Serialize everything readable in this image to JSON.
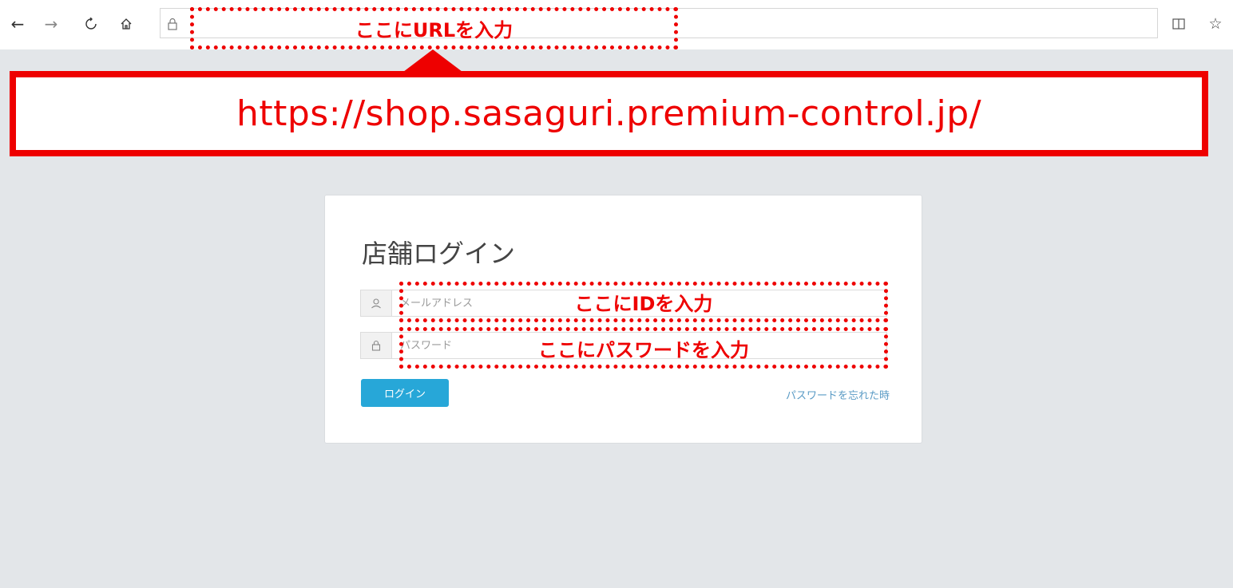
{
  "browser": {
    "back_icon": "arrow-left-icon",
    "forward_icon": "arrow-right-icon",
    "refresh_icon": "refresh-icon",
    "home_icon": "home-icon",
    "lock_icon": "lock-icon",
    "url_value": "",
    "reading_icon": "book-icon",
    "favorite_icon": "star-icon"
  },
  "annotations": {
    "url_hint": "ここにURLを入力",
    "url_banner": "https://shop.sasaguri.premium-control.jp/",
    "id_hint": "ここにIDを入力",
    "password_hint": "ここにパスワードを入力",
    "color": "#ee0000"
  },
  "login": {
    "title": "店舗ログイン",
    "email_placeholder": "メールアドレス",
    "password_placeholder": "パスワード",
    "login_button": "ログイン",
    "forgot_link": "パスワードを忘れた時",
    "button_color": "#27a7d8"
  }
}
